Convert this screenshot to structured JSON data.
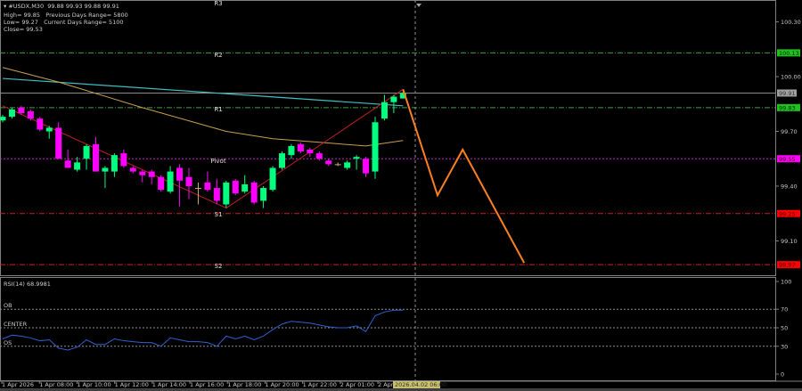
{
  "header": {
    "symbol_line": "#USDX,M30  99.88 99.93 99.88 99.91",
    "high": "High= 99.85",
    "prev_range": "Previous Days Range= 5800",
    "low": "Low= 99.27",
    "curr_range": "Current Days Range= 5100",
    "close": "Close= 99.53"
  },
  "rsi_label": "RSI(14) 68.9981",
  "colors": {
    "bull": "#00ff7f",
    "bear": "#ff00ff",
    "doji": "#c8b070",
    "ma_fast": "#c8a050",
    "ma_slow": "#40c0c0",
    "zigzag": "#c02020",
    "projection": "#ff8020",
    "rsi": "#3060d0",
    "r_level": "#40a040",
    "pivot": "#c020c0",
    "s_level": "#d02020"
  },
  "chart_data": {
    "type": "candlestick",
    "ylim": [
      98.95,
      100.4
    ],
    "y_ticks": [
      "100.30",
      "100.00",
      "99.70",
      "99.40",
      "99.10"
    ],
    "x_ticks": [
      "1 Apr 2026",
      "1 Apr 08:00",
      "1 Apr 10:00",
      "1 Apr 12:00",
      "1 Apr 14:00",
      "1 Apr 16:00",
      "1 Apr 18:00",
      "1 Apr 20:00",
      "1 Apr 22:00",
      "2 Apr 01:00",
      "2 Apr"
    ],
    "cursor_time": "2026.04.02 06:00",
    "candles": [
      [
        99.76,
        99.79,
        99.75,
        99.78
      ],
      [
        99.78,
        99.83,
        99.77,
        99.82
      ],
      [
        99.83,
        99.84,
        99.79,
        99.8
      ],
      [
        99.81,
        99.82,
        99.76,
        99.77
      ],
      [
        99.77,
        99.78,
        99.7,
        99.71
      ],
      [
        99.7,
        99.73,
        99.66,
        99.72
      ],
      [
        99.72,
        99.75,
        99.55,
        99.55
      ],
      [
        99.54,
        99.6,
        99.5,
        99.5
      ],
      [
        99.49,
        99.56,
        99.48,
        99.53
      ],
      [
        99.55,
        99.63,
        99.49,
        99.62
      ],
      [
        99.63,
        99.67,
        99.48,
        99.48
      ],
      [
        99.48,
        99.51,
        99.39,
        99.5
      ],
      [
        99.48,
        99.58,
        99.45,
        99.57
      ],
      [
        99.58,
        99.6,
        99.5,
        99.51
      ],
      [
        99.5,
        99.51,
        99.47,
        99.48
      ],
      [
        99.48,
        99.49,
        99.42,
        99.46
      ],
      [
        99.48,
        99.49,
        99.41,
        99.45
      ],
      [
        99.45,
        99.46,
        99.37,
        99.38
      ],
      [
        99.37,
        99.51,
        99.36,
        99.48
      ],
      [
        99.5,
        99.52,
        99.29,
        99.43
      ],
      [
        99.45,
        99.5,
        99.33,
        99.4
      ],
      [
        99.39,
        99.42,
        99.3,
        99.39
      ],
      [
        99.42,
        99.48,
        99.37,
        99.38
      ],
      [
        99.39,
        99.44,
        99.3,
        99.32
      ],
      [
        99.3,
        99.43,
        99.28,
        99.42
      ],
      [
        99.43,
        99.44,
        99.35,
        99.36
      ],
      [
        99.37,
        99.46,
        99.36,
        99.41
      ],
      [
        99.42,
        99.43,
        99.3,
        99.31
      ],
      [
        99.32,
        99.4,
        99.28,
        99.39
      ],
      [
        99.38,
        99.51,
        99.37,
        99.5
      ],
      [
        99.5,
        99.59,
        99.49,
        99.58
      ],
      [
        99.57,
        99.63,
        99.55,
        99.62
      ],
      [
        99.63,
        99.64,
        99.58,
        99.59
      ],
      [
        99.6,
        99.61,
        99.56,
        99.58
      ],
      [
        99.58,
        99.59,
        99.54,
        99.55
      ],
      [
        99.54,
        99.55,
        99.51,
        99.52
      ],
      [
        99.52,
        99.53,
        99.51,
        99.52
      ],
      [
        99.5,
        99.54,
        99.49,
        99.53
      ],
      [
        99.55,
        99.57,
        99.49,
        99.56
      ],
      [
        99.55,
        99.56,
        99.45,
        99.47
      ],
      [
        99.48,
        99.78,
        99.44,
        99.75
      ],
      [
        99.77,
        99.9,
        99.76,
        99.86
      ],
      [
        99.86,
        99.9,
        99.8,
        99.89
      ],
      [
        99.88,
        99.93,
        99.88,
        99.91
      ]
    ],
    "ma_fast": [
      [
        0,
        100.05
      ],
      [
        6,
        99.97
      ],
      [
        15,
        99.83
      ],
      [
        24,
        99.7
      ],
      [
        29,
        99.66
      ],
      [
        34,
        99.64
      ],
      [
        39,
        99.62
      ],
      [
        43,
        99.65
      ]
    ],
    "ma_slow": [
      [
        0,
        99.99
      ],
      [
        43,
        99.84
      ]
    ],
    "zigzag": [
      [
        0,
        99.84
      ],
      [
        24,
        99.28
      ],
      [
        43,
        99.93
      ]
    ],
    "projection": [
      [
        43,
        99.93
      ],
      [
        46.7,
        99.35
      ],
      [
        49.4,
        99.6
      ],
      [
        56,
        98.98
      ]
    ],
    "levels": [
      {
        "name": "R3",
        "value": null,
        "label": "R3"
      },
      {
        "name": "R2",
        "value": 100.13,
        "label": "R2",
        "tag": "100.13"
      },
      {
        "name": "R1",
        "value": 99.83,
        "label": "R1",
        "tag": "99.83"
      },
      {
        "name": "Pivot",
        "value": 99.55,
        "label": "Pivot",
        "tag": "99.55"
      },
      {
        "name": "S1",
        "value": 99.25,
        "label": "S1",
        "tag": "99.25"
      },
      {
        "name": "S2",
        "value": 98.97,
        "label": "S2",
        "tag": "98.97"
      }
    ],
    "bid": {
      "value": 99.91,
      "tag": "99.91"
    },
    "rsi": {
      "period": 14,
      "ylim": [
        0,
        100
      ],
      "y_ticks": [
        "100",
        "70",
        "50",
        "30",
        "0"
      ],
      "bands": [
        {
          "label": "OB",
          "value": 70
        },
        {
          "label": "CENTER",
          "value": 50
        },
        {
          "label": "OS",
          "value": 30
        }
      ],
      "values": [
        38,
        42,
        41,
        39,
        36,
        37,
        28,
        26,
        29,
        37,
        32,
        32,
        38,
        36,
        35,
        34,
        34,
        30,
        39,
        37,
        35,
        35,
        34,
        30,
        41,
        38,
        41,
        37,
        41,
        48,
        54,
        57,
        56,
        55,
        53,
        51,
        50,
        50,
        52,
        46,
        63,
        67,
        69,
        69
      ]
    }
  }
}
